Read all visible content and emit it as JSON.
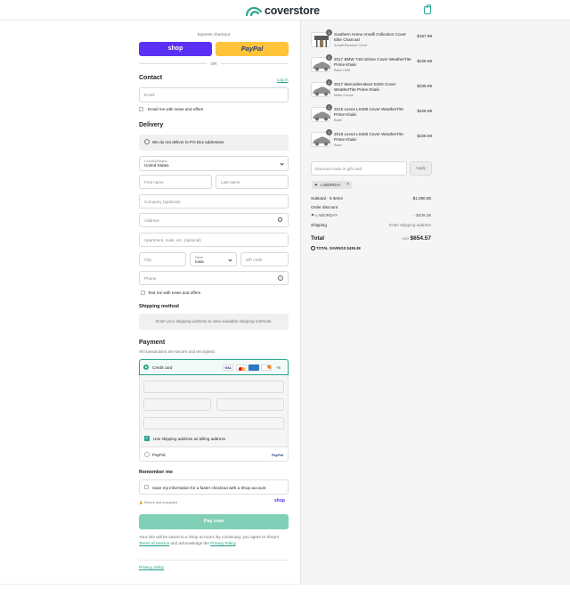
{
  "brand": {
    "name": "coverstore",
    "accent": "#2aa68d"
  },
  "express": {
    "label": "Express checkout",
    "shop_label": "shop",
    "paypal_label": "PayPal",
    "or_label": "OR"
  },
  "contact": {
    "title": "Contact",
    "login_label": "Log in",
    "email_placeholder": "Email",
    "newsletter_label": "Email me with news and offers"
  },
  "delivery": {
    "title": "Delivery",
    "notice": "We do not deliver to PO Box addresses.",
    "country_label": "Country/Region",
    "country_value": "United States",
    "first_name": "First name",
    "last_name": "Last name",
    "company": "Company (optional)",
    "address": "Address",
    "apartment": "Apartment, suite, etc. (optional)",
    "city": "City",
    "state_label": "State",
    "state_value": "Iowa",
    "zip": "ZIP code",
    "phone": "Phone",
    "sms_label": "Text me with news and offers"
  },
  "shipping_method": {
    "title": "Shipping method",
    "message": "Enter your shipping address to view available shipping methods."
  },
  "payment": {
    "title": "Payment",
    "subtitle": "All transactions are secure and encrypted.",
    "credit_card_label": "Credit card",
    "more_cards": "+5",
    "billing_label": "Use shipping address as billing address",
    "paypal_label": "PayPal",
    "paypal_logo": "PayPal"
  },
  "remember": {
    "title": "Remember me",
    "save_label": "Save my information for a faster checkout with a Shop account",
    "secure_label": "Secure and encrypted",
    "shop_label": "shop"
  },
  "pay_button": "Pay now",
  "legal": {
    "line1": "Your info will be saved to a Shop account. By continuing, you agree to Shop's",
    "terms": "Terms of Service",
    "and_ack": "and acknowledge the",
    "privacy": "Privacy Policy",
    "privacy_policy_link": "Privacy policy"
  },
  "cart": {
    "items": [
      {
        "qty": "1",
        "name": "Southern Home Amalfi Collection Cover Elite Charcoal",
        "variant": "Amalfi Barstool Cover",
        "price": "$167.99"
      },
      {
        "qty": "1",
        "name": "2017 BMW 740i xDrive Cover WeatherTite Prime Khaki",
        "variant": "Base LWB",
        "price": "$228.99"
      },
      {
        "qty": "1",
        "name": "2017 Mercedes-Benz E400 Cover WeatherTite Prime Khaki",
        "variant": "Matic Coupe",
        "price": "$235.99"
      },
      {
        "qty": "1",
        "name": "2015 Lexus LS460 Cover WeatherTite Prime Khaki",
        "variant": "Base",
        "price": "$228.99"
      },
      {
        "qty": "1",
        "name": "2016 Lexus LS460 Cover WeatherTite Prime Khaki",
        "variant": "Base",
        "price": "$228.99"
      }
    ],
    "discount_placeholder": "Discount code or gift card",
    "apply_label": "Apply",
    "code_tag": "LABORDAY",
    "subtotal_label": "Subtotal · 5 items",
    "subtotal_value": "$1,090.95",
    "order_discount_label": "Order discount",
    "discount_code": "LABORDAY",
    "discount_value": "- $436.38",
    "shipping_label": "Shipping",
    "shipping_value": "Enter shipping address",
    "total_label": "Total",
    "currency": "USD",
    "total_value": "$654.57",
    "savings_label": "TOTAL SAVINGS",
    "savings_value": "$436.38"
  }
}
